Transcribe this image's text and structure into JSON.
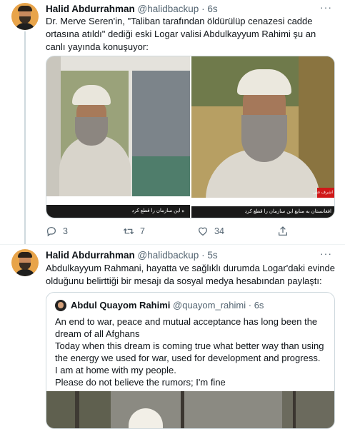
{
  "tweet1": {
    "author_name": "Halid Abdurrahman",
    "handle": "@halidbackup",
    "time": "6s",
    "text": "Dr. Merve Seren'in, \"Taliban tarafından öldürülüp cenazesi cadde ortasına atıldı\" dediği eski Logar valisi Abdulkayyum Rahimi şu an canlı yayında konuşuyor:",
    "video_caption_left": "ﻩ ﺍﯾﻦ ﺳﺎﺯﻣﺎﻥ ﺭﺍ ﻗﻄﻊ ﮐﺮﺩ",
    "video_caption_right": "ﺍﻓﻐﺎﻧﺴﺘﺎﻥ ﺑﻪ ﻣﻨﺎﺑﻊ ﺍﯾﻦ ﺳﺎﺯﻣﺎﻥ ﺭﺍ ﻗﻄﻊ ﮐﺮﺩ",
    "video_badge": "ﺍﺷﺮﻑ ﻏﻨﯽ",
    "replies": "3",
    "retweets": "7",
    "likes": "34"
  },
  "tweet2": {
    "author_name": "Halid Abdurrahman",
    "handle": "@halidbackup",
    "time": "5s",
    "text": "Abdulkayyum Rahmani, hayatta ve sağlıklı durumda Logar'daki evinde olduğunu belirttiği bir mesajı da sosyal medya hesabından paylaştı:",
    "quote": {
      "author_name": "Abdul Quayom Rahimi",
      "handle": "@quayom_rahimi",
      "time": "6s",
      "text": "An end to war, peace and mutual acceptance has long been the dream of all Afghans\nToday when this dream is coming true what better way than using the energy we used for war, used for development and progress.\nI am at home with my people.\nPlease do not believe the rumors; I'm fine"
    }
  },
  "colors": {
    "secondary_text": "#536471",
    "border": "#cfd9de"
  },
  "icons": {
    "reply": "reply-icon",
    "retweet": "retweet-icon",
    "like": "heart-icon",
    "share": "share-icon",
    "more": "more-icon"
  }
}
